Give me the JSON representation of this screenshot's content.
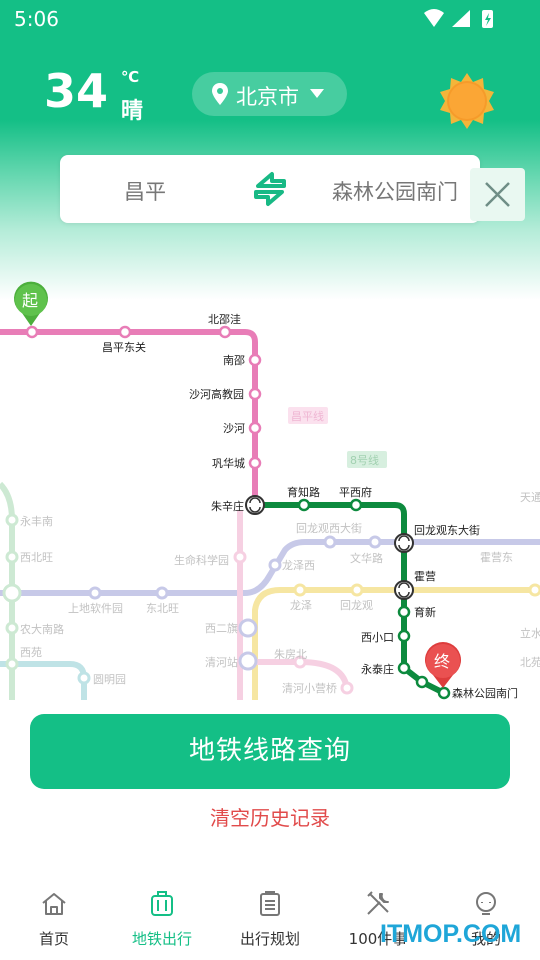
{
  "status_bar": {
    "time": "5:06"
  },
  "weather": {
    "temperature": "34",
    "unit": "℃",
    "condition": "晴"
  },
  "city": {
    "name": "北京市"
  },
  "route": {
    "from": "昌平",
    "to": "森林公园南门"
  },
  "map": {
    "markers": {
      "start": "起",
      "end": "终"
    },
    "stations": {
      "changping_dongguan": "昌平东关",
      "beishaowa": "北邵洼",
      "nanshao": "南邵",
      "shahe_gaojiaoyuan": "沙河高教园",
      "shahe": "沙河",
      "gonghuacheng": "巩华城",
      "zhuxinzhuang": "朱辛庄",
      "yuzhilu": "育知路",
      "pingxifu": "平西府",
      "huilongguan_dongdajie": "回龙观东大街",
      "huoying": "霍营",
      "yuxin": "育新",
      "xixiaokou": "西小口",
      "yongtaizhuang": "永泰庄",
      "senlingongyuan_nanmen": "森林公园南门",
      "yongfeng_nan": "永丰南",
      "xibeiwang": "西北旺",
      "nongda_nanlu": "农大南路",
      "xiyuan": "西苑",
      "yuanmingyuan": "圆明园",
      "shangdi_ruanjianyuan": "上地软件园",
      "dongbeiwang": "东北旺",
      "shengming_kexueyuan": "生命科学园",
      "xierqi": "西二旗",
      "qinghezhan": "清河站",
      "zhufangbei": "朱房北",
      "qinghe_xiaoyingqiao": "清河小营桥",
      "longze_xi": "龙泽西",
      "huilongguan_xidajie": "回龙观西大街",
      "wenhualu": "文华路",
      "longze": "龙泽",
      "huilongguan": "回龙观",
      "tiantongyuan": "天通",
      "huoyingdong": "霍营东",
      "tianbei": "天通",
      "lishuiqiao": "立水",
      "beiyuan": "北苑"
    },
    "line_labels": {
      "changping_line": "昌平线",
      "line8": "8号线"
    },
    "colors": {
      "changping": "#e87db7",
      "line8": "#0d8a3e",
      "faded_blue": "#c7c9e8",
      "faded_yellow": "#f6e6a2",
      "faded_green": "#cde9d3",
      "faded_cyan": "#bfe3e6"
    }
  },
  "actions": {
    "query": "地铁线路查询",
    "clear_history": "清空历史记录"
  },
  "nav": {
    "items": [
      {
        "label": "首页",
        "icon": "home-icon"
      },
      {
        "label": "地铁出行",
        "icon": "suitcase-icon"
      },
      {
        "label": "出行规划",
        "icon": "clipboard-icon"
      },
      {
        "label": "100件事",
        "icon": "tools-icon"
      },
      {
        "label": "我的",
        "icon": "profile-icon"
      }
    ],
    "active_index": 1
  },
  "watermark": "ITMOP.COM",
  "theme": {
    "primary": "#14bf86",
    "danger": "#e14b4b"
  }
}
